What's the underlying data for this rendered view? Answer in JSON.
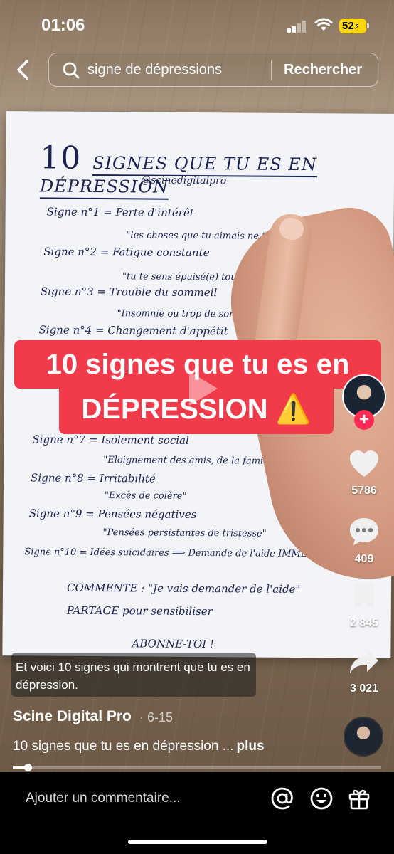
{
  "status_bar": {
    "time": "01:06",
    "battery": "52"
  },
  "search": {
    "query": "signe de dépressions",
    "button_label": "Rechercher"
  },
  "paper": {
    "title_number": "10",
    "title_text": "SIGNES QUE TU ES EN DÉPRESSION",
    "handle": "@scinedigitalpro",
    "lines": [
      {
        "label": "Signe n°1 =  Perte d'intérêt",
        "sub": "\"les choses que tu aimais ne t'intéressent plus\""
      },
      {
        "label": "Signe n°2 = Fatigue constante",
        "sub": "\"tu te sens épuisé(e) tout le temps\""
      },
      {
        "label": "Signe n°3 = Trouble du sommeil",
        "sub": "\"Insomnie ou trop de sommeil\""
      },
      {
        "label": "Signe n°4 = Changement d'appétit",
        "sub": ""
      },
      {
        "label": "Signe n°7 = Isolement social",
        "sub": "\"Eloignement des amis, de la famille\""
      },
      {
        "label": "Signe n°8 = Irritabilité",
        "sub": "\"Excès de colère\""
      },
      {
        "label": "Signe n°9 = Pensées négatives",
        "sub": "\"Pensées persistantes de tristesse\""
      },
      {
        "label": "Signe n°10 = Idées suicidaires ⟹ Demande de l'aide IMMÉDIATEMENT",
        "sub": ""
      }
    ],
    "comment_line": "COMMENTE : \"Je vais demander de l'aide\"",
    "share_line": "PARTAGE pour sensibiliser",
    "subscribe_line": "ABONNE-TOI !"
  },
  "caption": {
    "line1": "10 signes que tu es en",
    "line2": "DÉPRESSION ⚠️"
  },
  "rail": {
    "likes": "5786",
    "comments": "409",
    "bookmarks": "2 845",
    "shares": "3 021"
  },
  "subtitle": "Et voici 10 signes qui montrent que tu es en dépression.",
  "creator": {
    "name": "Scine Digital Pro",
    "date": "· 6-15"
  },
  "description": {
    "text": "10 signes que tu es en dépression ...",
    "more": "plus"
  },
  "progress": {
    "fraction": 0.04
  },
  "bottom": {
    "comment_placeholder": "Ajouter un commentaire..."
  },
  "colors": {
    "accent": "#fe2c55",
    "caption_bg": "#f23b4a",
    "battery": "#ffd60a"
  },
  "icons": [
    "back-icon",
    "search-icon",
    "play-icon",
    "heart-icon",
    "comment-icon",
    "bookmark-icon",
    "share-icon",
    "at-icon",
    "emoji-icon",
    "gift-icon"
  ]
}
